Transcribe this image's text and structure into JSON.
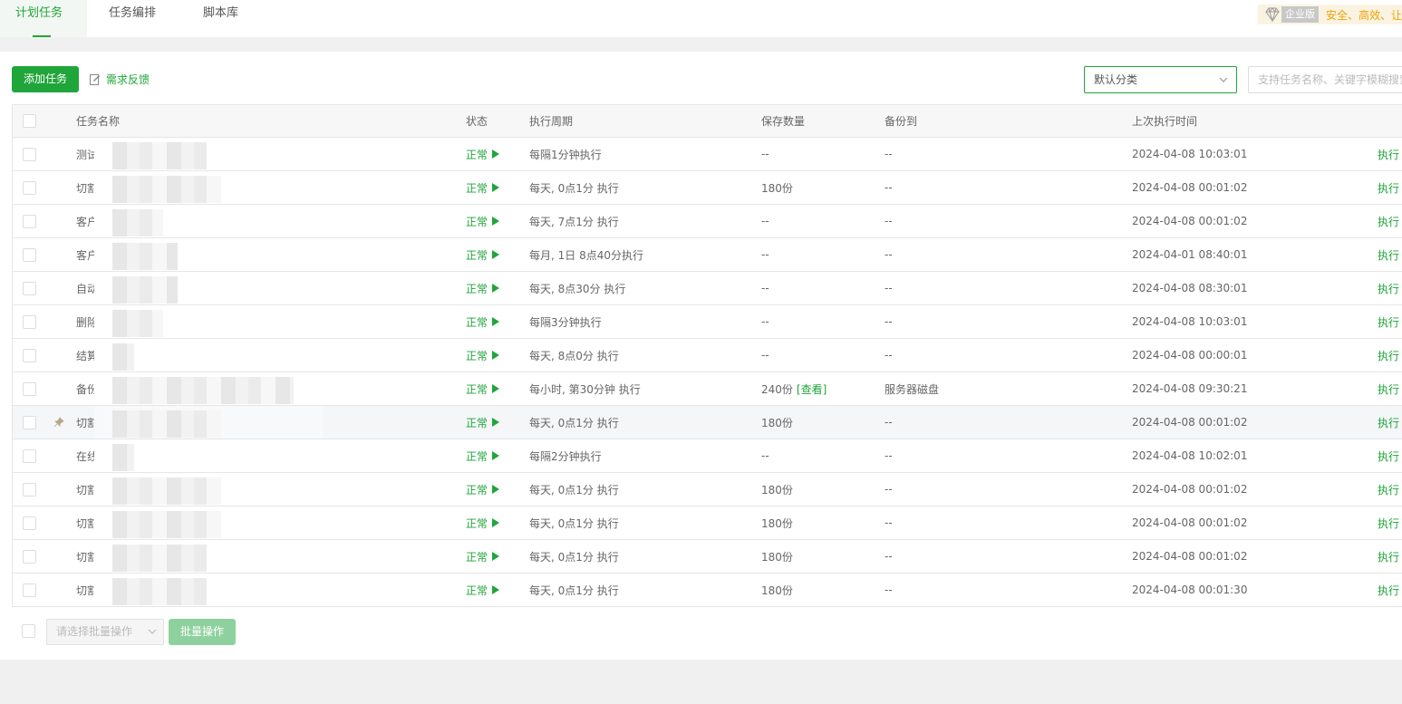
{
  "tabs": [
    {
      "label": "计划任务",
      "active": true
    },
    {
      "label": "任务编排",
      "active": false
    },
    {
      "label": "脚本库",
      "active": false
    }
  ],
  "enterprise": {
    "badge": "企业版",
    "slogan": "安全、高效、让"
  },
  "toolbar": {
    "add_label": "添加任务",
    "feedback_label": "需求反馈",
    "category_value": "默认分类",
    "search_placeholder": "支持任务名称、关键字模糊搜索"
  },
  "colors": {
    "accent": "#20a53a",
    "enterprise": "#f0a000"
  },
  "table": {
    "headers": {
      "name": "任务名称",
      "status": "状态",
      "cycle": "执行周期",
      "save": "保存数量",
      "backup": "备份到",
      "last": "上次执行时间"
    },
    "rows": [
      {
        "name": "测试",
        "status": "正常",
        "cycle": "每隔1分钟执行",
        "save": "--",
        "backup": "--",
        "last": "2024-04-08 10:03:01",
        "op": "执行"
      },
      {
        "name": "切割",
        "status": "正常",
        "cycle": "每天, 0点1分 执行",
        "save": "180份",
        "backup": "--",
        "last": "2024-04-08 00:01:02",
        "op": "执行"
      },
      {
        "name": "客户",
        "status": "正常",
        "cycle": "每天, 7点1分 执行",
        "save": "--",
        "backup": "--",
        "last": "2024-04-08 00:01:02",
        "op": "执行"
      },
      {
        "name": "客户",
        "status": "正常",
        "cycle": "每月, 1日 8点40分执行",
        "save": "--",
        "backup": "--",
        "last": "2024-04-01 08:40:01",
        "op": "执行"
      },
      {
        "name": "自动",
        "status": "正常",
        "cycle": "每天, 8点30分 执行",
        "save": "--",
        "backup": "--",
        "last": "2024-04-08 08:30:01",
        "op": "执行"
      },
      {
        "name": "删除",
        "status": "正常",
        "cycle": "每隔3分钟执行",
        "save": "--",
        "backup": "--",
        "last": "2024-04-08 10:03:01",
        "op": "执行"
      },
      {
        "name": "结算",
        "status": "正常",
        "cycle": "每天, 8点0分 执行",
        "save": "--",
        "backup": "--",
        "last": "2024-04-08 00:00:01",
        "op": "执行"
      },
      {
        "name": "备份",
        "status": "正常",
        "cycle": "每小时, 第30分钟 执行",
        "save": "240份",
        "save_link": "[查看]",
        "backup": "服务器磁盘",
        "last": "2024-04-08 09:30:21",
        "op": "执行"
      },
      {
        "name": "切割",
        "status": "正常",
        "cycle": "每天, 0点1分 执行",
        "save": "180份",
        "backup": "--",
        "last": "2024-04-08 00:01:02",
        "op": "执行",
        "pinned": true
      },
      {
        "name": "在线",
        "status": "正常",
        "cycle": "每隔2分钟执行",
        "save": "--",
        "backup": "--",
        "last": "2024-04-08 10:02:01",
        "op": "执行"
      },
      {
        "name": "切割",
        "status": "正常",
        "cycle": "每天, 0点1分 执行",
        "save": "180份",
        "backup": "--",
        "last": "2024-04-08 00:01:02",
        "op": "执行"
      },
      {
        "name": "切割",
        "status": "正常",
        "cycle": "每天, 0点1分 执行",
        "save": "180份",
        "backup": "--",
        "last": "2024-04-08 00:01:02",
        "op": "执行"
      },
      {
        "name": "切割",
        "status": "正常",
        "cycle": "每天, 0点1分 执行",
        "save": "180份",
        "backup": "--",
        "last": "2024-04-08 00:01:02",
        "op": "执行"
      },
      {
        "name": "切割",
        "status": "正常",
        "cycle": "每天, 0点1分 执行",
        "save": "180份",
        "backup": "--",
        "last": "2024-04-08 00:01:30",
        "op": "执行"
      }
    ]
  },
  "footer": {
    "batch_placeholder": "请选择批量操作",
    "batch_button": "批量操作"
  }
}
